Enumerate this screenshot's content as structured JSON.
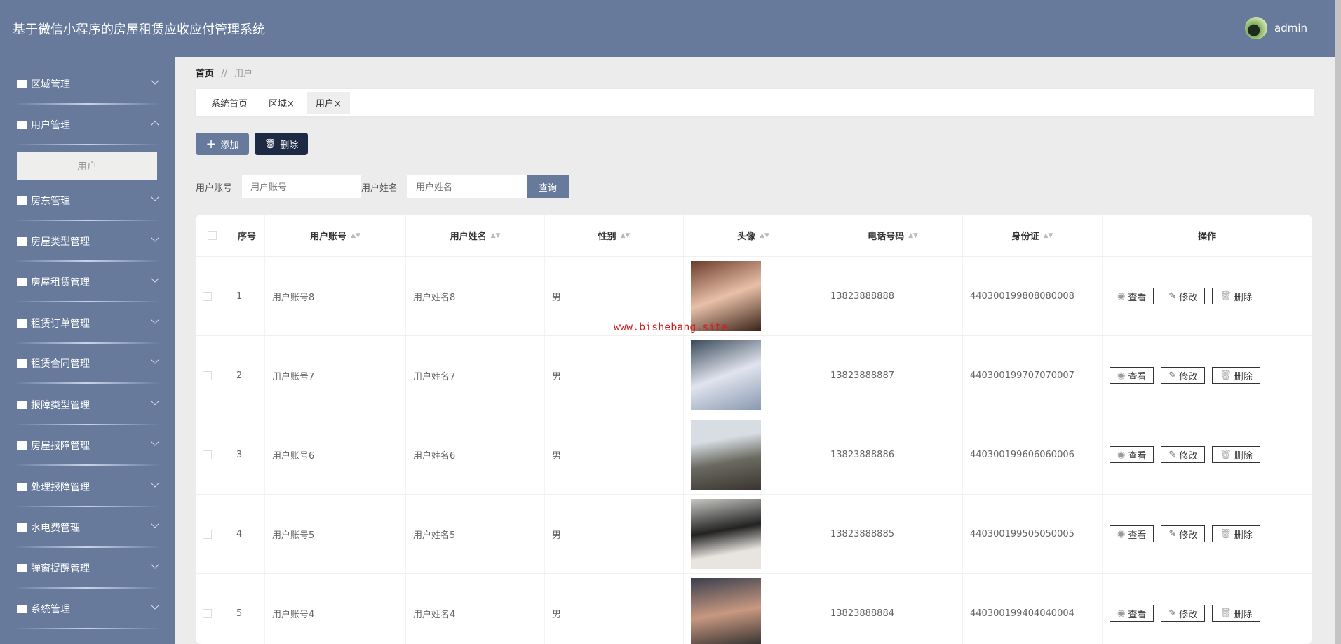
{
  "header": {
    "title": "基于微信小程序的房屋租赁应收应付管理系统",
    "username": "admin"
  },
  "sidebar": {
    "items": [
      {
        "label": "区域管理",
        "icon": "ticket-icon"
      },
      {
        "label": "用户管理",
        "icon": "grid-icon",
        "expanded": true
      },
      {
        "label": "房东管理",
        "icon": "briefcase-icon"
      },
      {
        "label": "房屋类型管理",
        "icon": "house-icon"
      },
      {
        "label": "房屋租赁管理",
        "icon": "clipboard-icon"
      },
      {
        "label": "租赁订单管理",
        "icon": "grid-icon"
      },
      {
        "label": "租赁合同管理",
        "icon": "grid-icon"
      },
      {
        "label": "报障类型管理",
        "icon": "flag-icon"
      },
      {
        "label": "房屋报障管理",
        "icon": "grid-icon"
      },
      {
        "label": "处理报障管理",
        "icon": "grid-icon"
      },
      {
        "label": "水电费管理",
        "icon": "sliders-icon"
      },
      {
        "label": "弹窗提醒管理",
        "icon": "chart-icon"
      },
      {
        "label": "系统管理",
        "icon": "monitor-icon"
      }
    ],
    "sub_item": "用户"
  },
  "breadcrumb": {
    "home": "首页",
    "sep": "//",
    "current": "用户"
  },
  "tabs": [
    "系统首页",
    "区域×",
    "用户×"
  ],
  "toolbar": {
    "add": "添加",
    "delete": "删除"
  },
  "search": {
    "account_label": "用户账号",
    "account_placeholder": "用户账号",
    "name_label": "用户姓名",
    "name_placeholder": "用户姓名",
    "query": "查询"
  },
  "table": {
    "columns": [
      "序号",
      "用户账号",
      "用户姓名",
      "性别",
      "头像",
      "电话号码",
      "身份证",
      "操作"
    ],
    "rows": [
      {
        "no": "1",
        "account": "用户账号8",
        "name": "用户姓名8",
        "gender": "男",
        "phone": "13823888888",
        "id": "440300199808080008"
      },
      {
        "no": "2",
        "account": "用户账号7",
        "name": "用户姓名7",
        "gender": "男",
        "phone": "13823888887",
        "id": "440300199707070007"
      },
      {
        "no": "3",
        "account": "用户账号6",
        "name": "用户姓名6",
        "gender": "男",
        "phone": "13823888886",
        "id": "440300199606060006"
      },
      {
        "no": "4",
        "account": "用户账号5",
        "name": "用户姓名5",
        "gender": "男",
        "phone": "13823888885",
        "id": "440300199505050005"
      },
      {
        "no": "5",
        "account": "用户账号4",
        "name": "用户姓名4",
        "gender": "男",
        "phone": "13823888884",
        "id": "440300199404040004"
      }
    ],
    "actions": {
      "view": "查看",
      "edit": "修改",
      "delete": "删除"
    }
  },
  "watermark": "www.bishebang.site"
}
